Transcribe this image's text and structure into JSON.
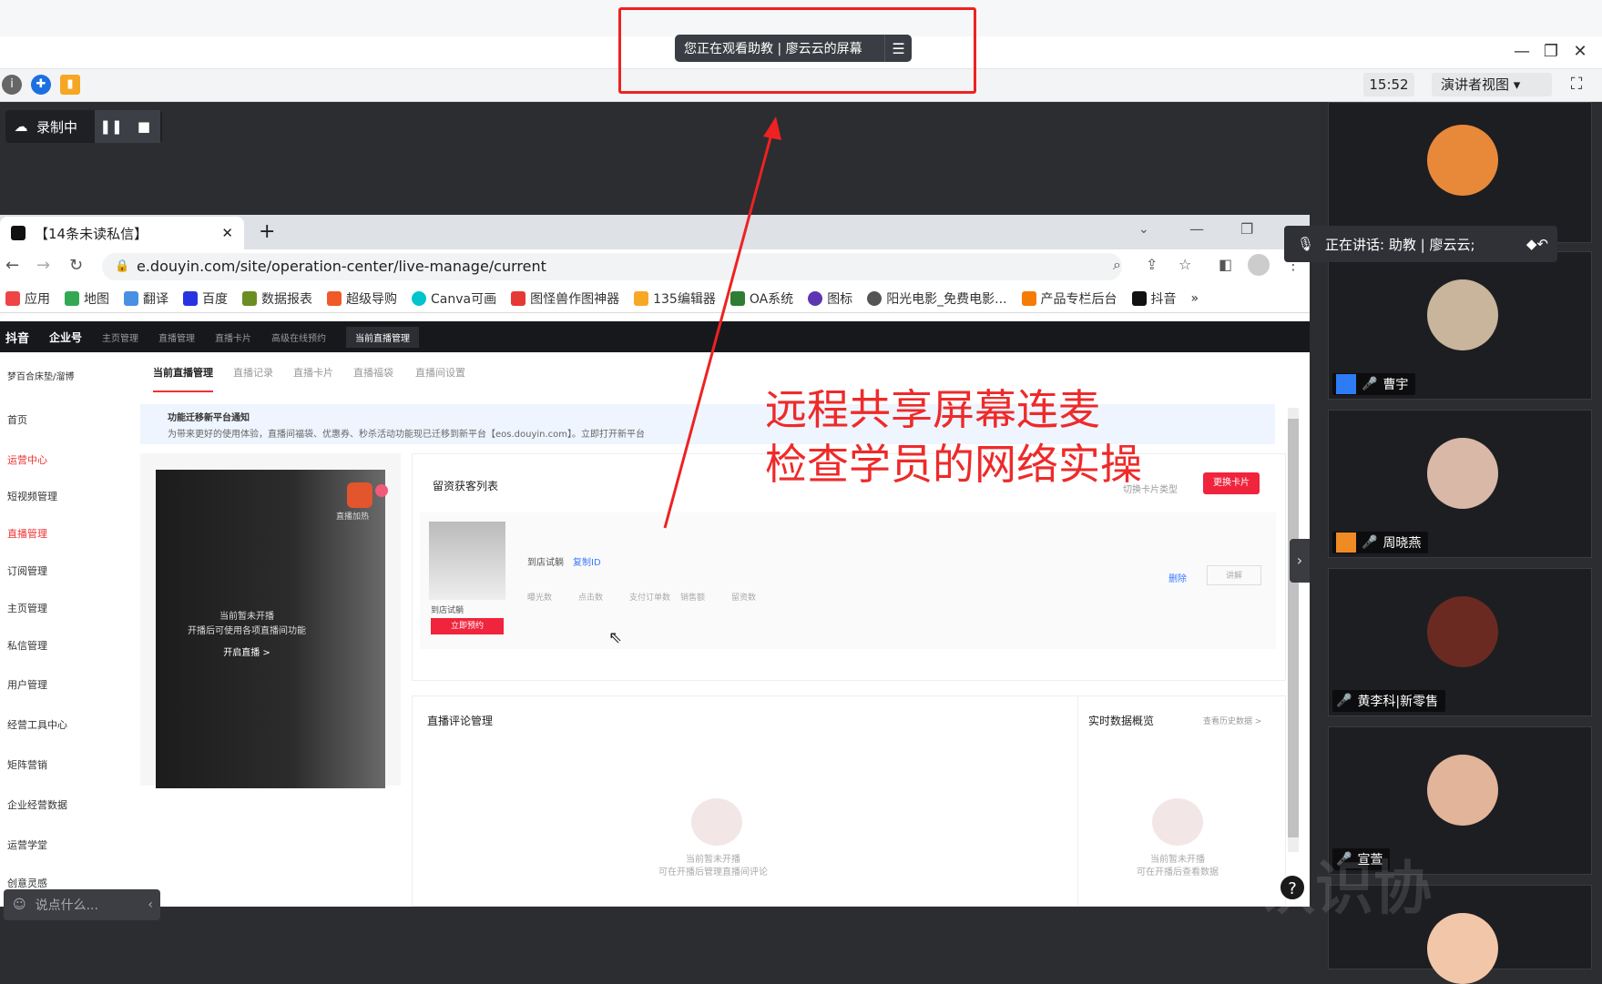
{
  "meeting": {
    "viewing_label": "您正在观看助教 | 廖云云的屏幕",
    "menu_glyph": "☰",
    "clock": "15:52",
    "presenter_view": "演讲者视图",
    "recording_label": "录制中",
    "speaking_label": "正在讲话: 助教 | 廖云云;",
    "chat_placeholder": "说点什么...",
    "help": "?",
    "watermark": "认识协"
  },
  "browser": {
    "tab_title": "【14条未读私信】",
    "url": "e.douyin.com/site/operation-center/live-manage/current",
    "bookmarks": [
      "应用",
      "地图",
      "翻译",
      "百度",
      "数据报表",
      "超级导购",
      "Canva可画",
      "图怪兽作图神器",
      "135编辑器",
      "OA系统",
      "图标",
      "阳光电影_免费电影...",
      "产品专栏后台",
      "抖音"
    ]
  },
  "douyin": {
    "header": [
      "抖音",
      "企业号",
      "主页管理",
      "直播管理",
      "直播卡片",
      "高级在线预约",
      "当前直播管理"
    ],
    "account": "梦百合床垫/溜博",
    "subtabs": [
      "当前直播管理",
      "直播记录",
      "直播卡片",
      "直播福袋",
      "直播间设置"
    ],
    "nav": [
      "首页",
      "运营中心",
      "短视频管理",
      "直播管理",
      "订阅管理",
      "主页管理",
      "私信管理",
      "用户管理",
      "经营工具中心",
      "矩阵营销",
      "企业经营数据",
      "运营学堂",
      "创意灵感"
    ],
    "notice_title": "功能迁移新平台通知",
    "notice_body": "为带来更好的使用体验，直播间福袋、优惠券、秒杀活动功能现已迁移到新平台【eos.douyin.com】。立即打开新平台",
    "live_status": "当前暂未开播",
    "live_hint": "开播后可使用各项直播间功能",
    "live_start": "开启直播 >",
    "live_boost": "直播加热",
    "card_section_title": "留资获客列表",
    "card_switch": "切换卡片类型",
    "card_change_btn": "更换卡片",
    "card_name": "到店试躺",
    "card_copy_id": "复制ID",
    "card_thumb_label": "到店试躺",
    "card_reserve_btn": "立即预约",
    "card_stats": [
      "曝光数",
      "点击数",
      "支付订单数",
      "销售额",
      "留资数"
    ],
    "card_delete": "删除",
    "card_explain": "讲解",
    "comments_title": "直播评论管理",
    "realtime_title": "实时数据概览",
    "history_link": "查看历史数据 >",
    "empty1_line1": "当前暂未开播",
    "empty1_line2": "可在开播后管理直播间评论",
    "empty2_line1": "当前暂未开播",
    "empty2_line2": "可在开播后查看数据"
  },
  "annotation": {
    "line1": "远程共享屏幕连麦",
    "line2": "检查学员的网络实操",
    "color": "#ee2a2a"
  },
  "participants": [
    {
      "name": "",
      "avatar_color": "#e8893a"
    },
    {
      "name": "曹宇",
      "avatar_color": "#c9b49c"
    },
    {
      "name": "周晓燕",
      "avatar_color": "#d9b8a8"
    },
    {
      "name": "黄李科|新零售",
      "avatar_color": "#6a2a22"
    },
    {
      "name": "宣萱",
      "avatar_color": "#e2b49a"
    }
  ]
}
